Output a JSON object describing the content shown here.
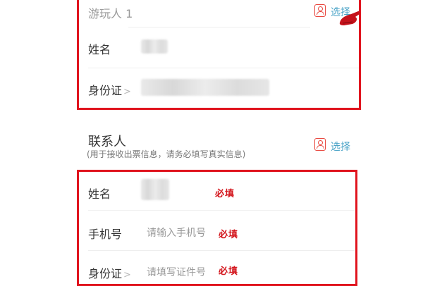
{
  "passenger": {
    "placeholder": "游玩人 1",
    "select_label": "选择",
    "name_label": "姓名",
    "id_label": "身份证",
    "id_chevron": ">"
  },
  "contact": {
    "title": "联系人",
    "subtitle": "(用于接收出票信息，请务必填写真实信息)",
    "select_label": "选择",
    "name_label": "姓名",
    "name_required": "必填",
    "phone_label": "手机号",
    "phone_placeholder": "请输入手机号",
    "phone_required": "必填",
    "id_label": "身份证",
    "id_chevron": ">",
    "id_placeholder": "请填写证件号",
    "id_required": "必填"
  },
  "colors": {
    "highlight_border": "#e0141e",
    "required_text": "#d3141b",
    "link_text": "#4aa3c7",
    "icon": "#e8453c"
  },
  "icons": [
    "contact-book-icon",
    "hand-pointer-icon"
  ]
}
